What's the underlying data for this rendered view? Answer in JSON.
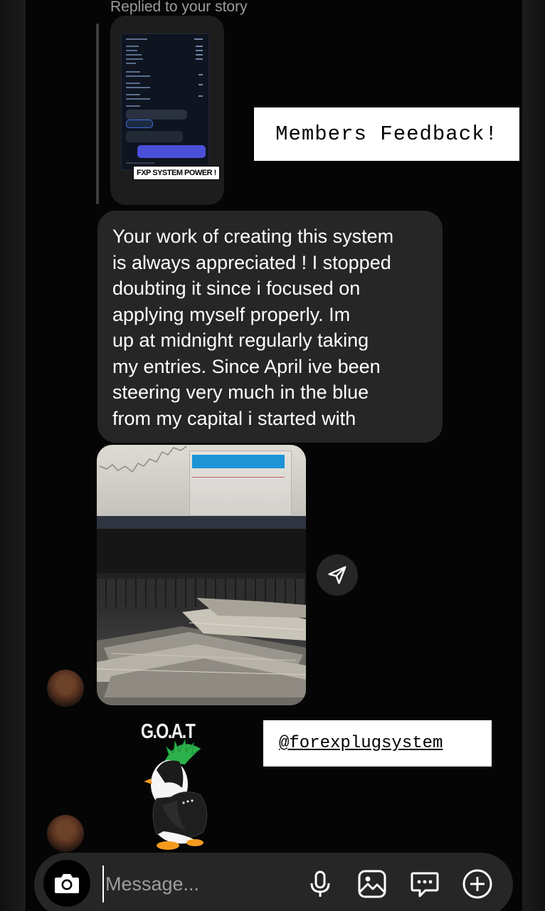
{
  "header": {
    "reply_caption": "Replied to your story"
  },
  "story": {
    "sticker_text": "FXP SYSTEM POWER !"
  },
  "overlay": {
    "feedback_title": "Members Feedback!",
    "handle": "@forexplugsystem"
  },
  "message": {
    "lines": [
      "Your work of creating this system",
      "is always appreciated ! I stopped",
      "doubting it since i focused on",
      "applying myself properly. Im",
      "up at midnight regularly taking",
      "my entries. Since April ive been",
      "steering very much in the blue",
      "from my capital i started with"
    ]
  },
  "sticker": {
    "label": "G.O.A.T"
  },
  "composer": {
    "placeholder": "Message..."
  },
  "icons": {
    "share": "send-icon",
    "camera": "camera-icon",
    "mic": "microphone-icon",
    "gallery": "image-icon",
    "chat": "chat-bubble-icon",
    "add": "plus-circle-icon"
  },
  "colors": {
    "background": "#050505",
    "bubble": "#262626",
    "caption": "#9c9c9c",
    "accent_green": "#2db14b"
  }
}
